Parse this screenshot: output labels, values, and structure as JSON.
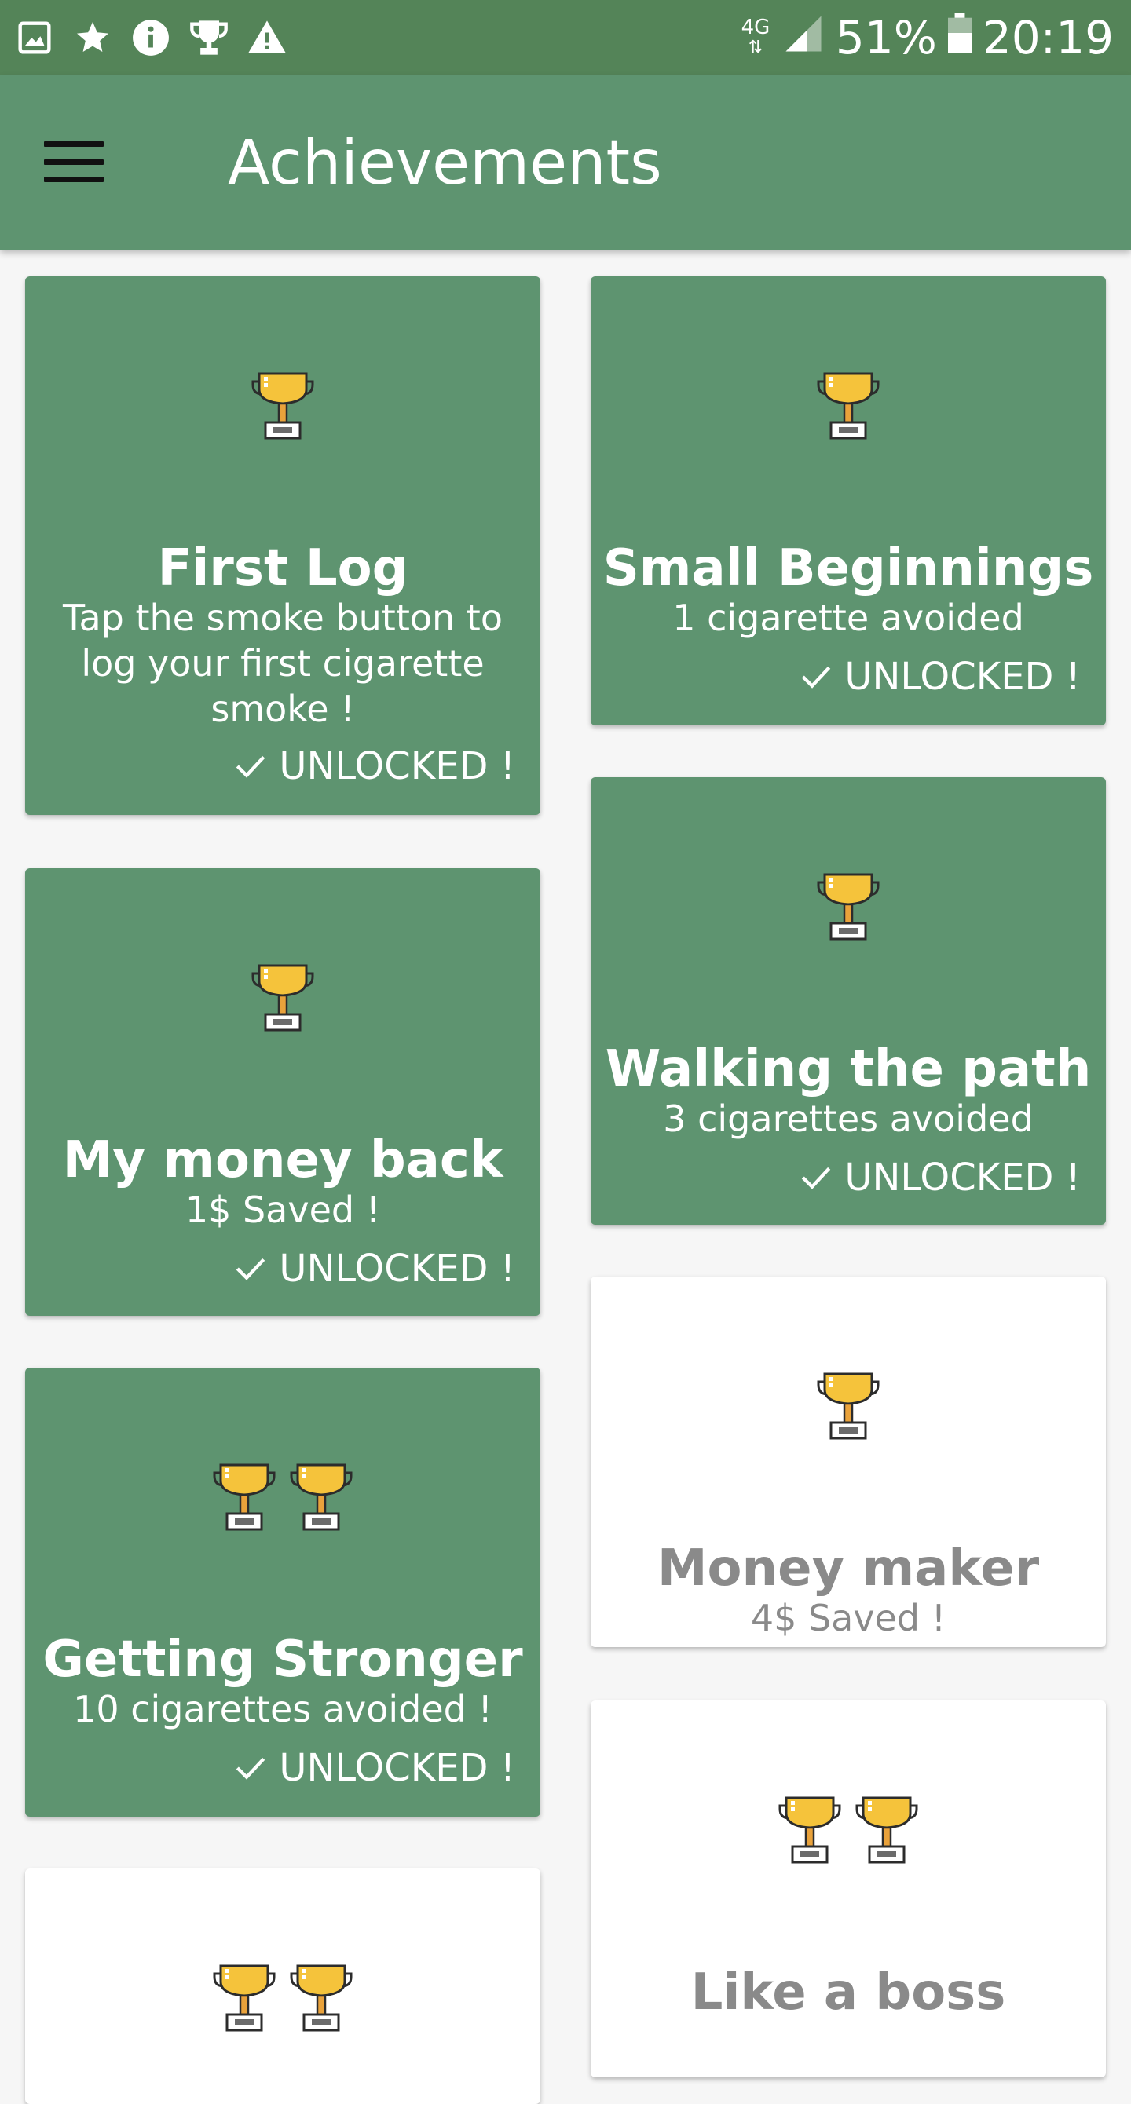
{
  "status_bar": {
    "icons": [
      "image-icon",
      "star-icon",
      "info-icon",
      "trophy-icon",
      "warning-icon"
    ],
    "network": "4G",
    "battery": "51%",
    "time": "20:19"
  },
  "app_bar": {
    "title": "Achievements",
    "menu_icon": "hamburger-menu-icon"
  },
  "colors": {
    "card_unlocked": "#5e9470",
    "app_bar": "#5e9470",
    "status_bar": "#548458",
    "trophy_gold": "#f5c33b"
  },
  "achievements": [
    {
      "name": "First Log",
      "description": "Tap the smoke button to log your first cigarette smoke !",
      "status": "UNLOCKED !",
      "unlocked": true,
      "trophies": 1
    },
    {
      "name": "Small Beginnings",
      "description": "1 cigarette avoided",
      "status": "UNLOCKED !",
      "unlocked": true,
      "trophies": 1
    },
    {
      "name": "My money back",
      "description": "1$ Saved !",
      "status": "UNLOCKED !",
      "unlocked": true,
      "trophies": 1
    },
    {
      "name": "Walking the path",
      "description": "3 cigarettes avoided",
      "status": "UNLOCKED !",
      "unlocked": true,
      "trophies": 1
    },
    {
      "name": "Money maker",
      "description": "4$ Saved !",
      "status": "",
      "unlocked": false,
      "trophies": 1
    },
    {
      "name": "Getting Stronger",
      "description": "10 cigarettes avoided !",
      "status": "UNLOCKED !",
      "unlocked": true,
      "trophies": 2
    },
    {
      "name": "Like a boss",
      "description": "",
      "status": "",
      "unlocked": false,
      "trophies": 2
    },
    {
      "name": "",
      "description": "",
      "status": "",
      "unlocked": false,
      "trophies": 2
    }
  ]
}
